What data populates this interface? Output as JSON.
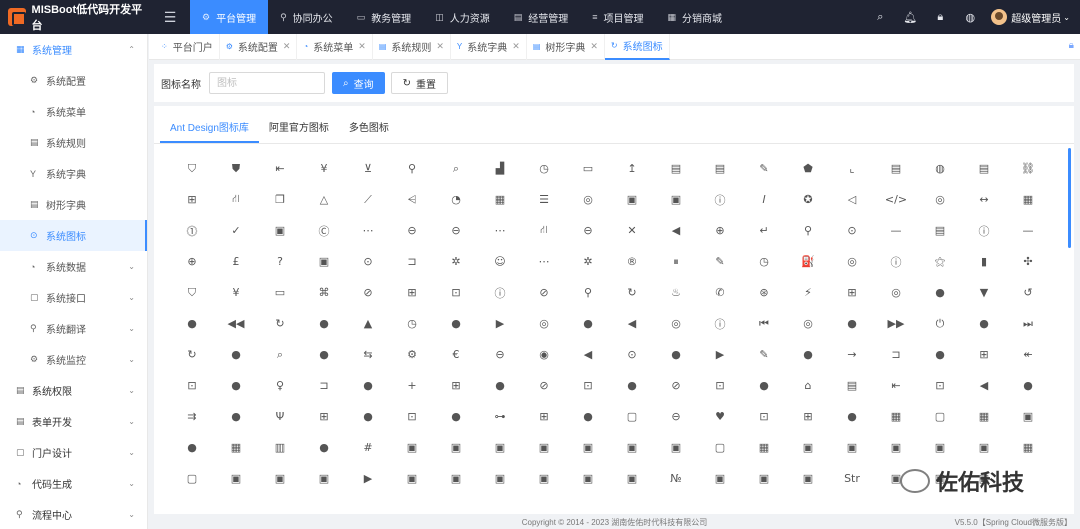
{
  "app": {
    "title": "MISBoot低代码开发平台",
    "fold_icon": "menu-fold-icon"
  },
  "topnav": [
    {
      "label": "平台管理",
      "icon": "⚙",
      "active": true
    },
    {
      "label": "协同办公",
      "icon": "⚲"
    },
    {
      "label": "教务管理",
      "icon": "▭"
    },
    {
      "label": "人力资源",
      "icon": "◫"
    },
    {
      "label": "经营管理",
      "icon": "▤"
    },
    {
      "label": "项目管理",
      "icon": "≡"
    },
    {
      "label": "分销商城",
      "icon": "▦"
    }
  ],
  "user": {
    "name": "超级管理员"
  },
  "sidebar": [
    {
      "label": "系统管理",
      "icon": "▦",
      "level": "top",
      "state": "top-active",
      "chev": "⌃"
    },
    {
      "label": "系统配置",
      "icon": "⚙",
      "level": "sub"
    },
    {
      "label": "系统菜单",
      "icon": "◔",
      "level": "sub"
    },
    {
      "label": "系统规则",
      "icon": "▤",
      "level": "sub"
    },
    {
      "label": "系统字典",
      "icon": "Y",
      "level": "sub"
    },
    {
      "label": "树形字典",
      "icon": "▤",
      "level": "sub"
    },
    {
      "label": "系统图标",
      "icon": "⊙",
      "level": "sub",
      "state": "selected"
    },
    {
      "label": "系统数据",
      "icon": "◔",
      "level": "sub",
      "chev": "⌄"
    },
    {
      "label": "系统接口",
      "icon": "▢",
      "level": "sub",
      "chev": "⌄"
    },
    {
      "label": "系统翻译",
      "icon": "⚲",
      "level": "sub",
      "chev": "⌄"
    },
    {
      "label": "系统监控",
      "icon": "⚙",
      "level": "sub",
      "chev": "⌄"
    },
    {
      "label": "系统权限",
      "icon": "▤",
      "level": "top",
      "chev": "⌄"
    },
    {
      "label": "表单开发",
      "icon": "▤",
      "level": "top",
      "chev": "⌄"
    },
    {
      "label": "门户设计",
      "icon": "▢",
      "level": "top",
      "chev": "⌄"
    },
    {
      "label": "代码生成",
      "icon": "◔",
      "level": "top",
      "chev": "⌄"
    },
    {
      "label": "流程中心",
      "icon": "⚲",
      "level": "top",
      "chev": "⌄"
    }
  ],
  "tabs": [
    {
      "label": "平台门户",
      "icon": "⁘",
      "closable": false
    },
    {
      "label": "系统配置",
      "icon": "⚙",
      "closable": true
    },
    {
      "label": "系统菜单",
      "icon": "◔",
      "closable": true
    },
    {
      "label": "系统规则",
      "icon": "▤",
      "closable": true
    },
    {
      "label": "系统字典",
      "icon": "Y",
      "closable": true
    },
    {
      "label": "树形字典",
      "icon": "▤",
      "closable": true
    },
    {
      "label": "系统图标",
      "icon": "↻",
      "closable": false,
      "active": true
    }
  ],
  "search": {
    "label": "图标名称",
    "placeholder": "图标",
    "query_label": "查询",
    "reset_label": "重置"
  },
  "icon_tabs": [
    {
      "label": "Ant Design图标库",
      "active": true
    },
    {
      "label": "阿里官方图标"
    },
    {
      "label": "多色图标"
    }
  ],
  "icons": [
    "⛉",
    "⛊",
    "⇤",
    "¥",
    "⊻",
    "⚲",
    "⌕",
    "▟",
    "◷",
    "▭",
    "↥",
    "▤",
    "▤",
    "✎",
    "⬟",
    "⌞",
    "▤",
    "◍",
    "▤",
    "⛓",
    "⊞",
    "⛙",
    "❐",
    "△",
    "⟋",
    "⩤",
    "◔",
    "▦",
    "☰",
    "◎",
    "▣",
    "▣",
    "ⓘ",
    "𝐼",
    "✪",
    "◁",
    "</>",
    "◎",
    "↔",
    "▦",
    "⓵",
    "✓",
    "▣",
    "Ⓒ",
    "⋯",
    "⊖",
    "⊖",
    "⋯",
    "⛙",
    "⊖",
    "✕",
    "◀",
    "⊕",
    "↵",
    "⚲",
    "⊙",
    "—",
    "▤",
    "ⓘ",
    "—",
    "⊕",
    "£",
    "?",
    "▣",
    "⊙",
    "⊐",
    "✲",
    "☺",
    "⋯",
    "✲",
    "®",
    "⏸",
    "✎",
    "◷",
    "⛽",
    "◎",
    "ⓘ",
    "⚝",
    "▮",
    "✣",
    "⛉",
    "¥",
    "▭",
    "⌘",
    "⊘",
    "⊞",
    "⊡",
    "ⓘ",
    "⊘",
    "⚲",
    "↻",
    "♨",
    "✆",
    "⊛",
    "⚡",
    "⊞",
    "◎",
    "●",
    "▼",
    "↺",
    "●",
    "◀◀",
    "↻",
    "●",
    "▲",
    "◷",
    "●",
    "▶",
    "◎",
    "●",
    "◀",
    "◎",
    "ⓘ",
    "⏮",
    "◎",
    "●",
    "▶▶",
    "⏻",
    "●",
    "⏭",
    "↻",
    "●",
    "⌕",
    "●",
    "⇆",
    "⚙",
    "€",
    "⊖",
    "◉",
    "◀",
    "⊙",
    "●",
    "▶",
    "✎",
    "●",
    "→",
    "⊐",
    "●",
    "⊞",
    "↞",
    "⊡",
    "●",
    "♀",
    "⊐",
    "●",
    "+",
    "⊞",
    "●",
    "⊘",
    "⊡",
    "●",
    "⊘",
    "⊡",
    "●",
    "⌂",
    "▤",
    "⇤",
    "⊡",
    "◀",
    "●",
    "⇉",
    "●",
    "Ψ",
    "⊞",
    "●",
    "⊡",
    "●",
    "⊶",
    "⊞",
    "●",
    "▢",
    "⊖",
    "♥",
    "⊡",
    "⊞",
    "●",
    "▦",
    "▢",
    "▦",
    "▣",
    "●",
    "▦",
    "▥",
    "●",
    "#",
    "▣",
    "▣",
    "▣",
    "▣",
    "▣",
    "▣",
    "▣",
    "▢",
    "▦",
    "▣",
    "▣",
    "▣",
    "▣",
    "▣",
    "▦",
    "▢",
    "▣",
    "▣",
    "▣",
    "▶",
    "▣",
    "▣",
    "▣",
    "▣",
    "▣",
    "▣",
    "№",
    "▣",
    "▣",
    "▣",
    "Str",
    "▣",
    "▣",
    "▣"
  ],
  "footer": {
    "copyright": "Copyright © 2014 - 2023 湖南佐佑时代科技有限公司",
    "version": "V5.5.0【Spring Cloud微服务版】"
  },
  "watermark": {
    "text": "佐佑科技"
  }
}
